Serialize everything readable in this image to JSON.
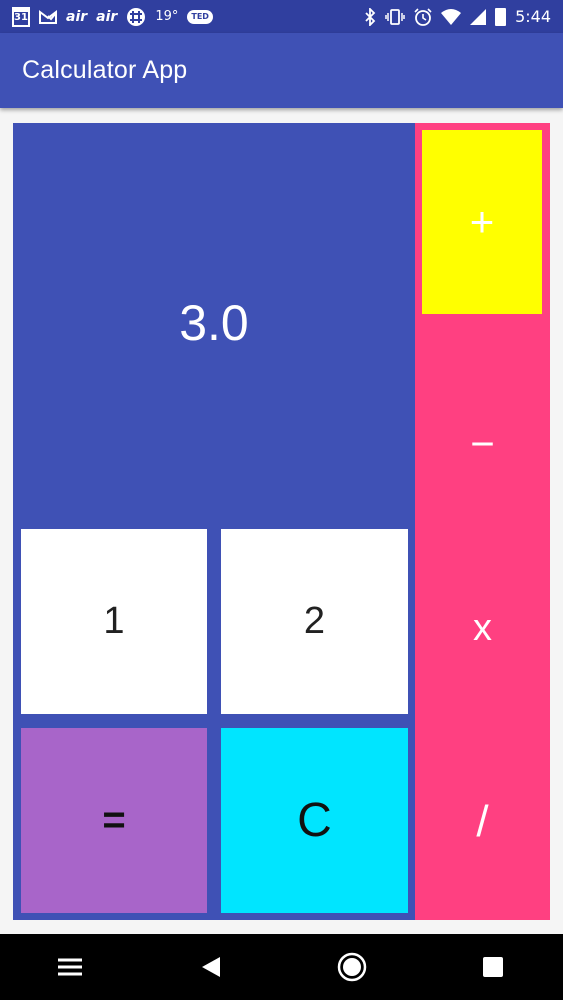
{
  "status_bar": {
    "calendar_day": "31",
    "icons": [
      "calendar-icon",
      "mail-check-icon",
      "air-icon",
      "air-icon",
      "slack-icon",
      "ted-icon",
      "bluetooth-icon",
      "vibrate-icon",
      "alarm-icon",
      "wifi-icon",
      "signal-icon",
      "battery-icon"
    ],
    "air_1": "air",
    "air_2": "air",
    "temperature": "19°",
    "ted": "TED",
    "time": "5:44"
  },
  "app_bar": {
    "title": "Calculator App"
  },
  "calculator": {
    "display_value": "3.0",
    "keys": {
      "one": "1",
      "two": "2",
      "equals": "=",
      "clear": "C"
    },
    "operators": {
      "plus": "+",
      "minus": "−",
      "multiply": "x",
      "divide": "/"
    }
  },
  "colors": {
    "primary": "#3f51b5",
    "primary_dark": "#303f9f",
    "accent": "#ff4081",
    "plus_key": "#ffff00",
    "equals_key": "#a865c9",
    "clear_key": "#00e5ff",
    "number_key": "#ffffff"
  },
  "nav_bar": {
    "icons": [
      "menu-icon",
      "back-icon",
      "home-icon",
      "recents-icon"
    ]
  }
}
